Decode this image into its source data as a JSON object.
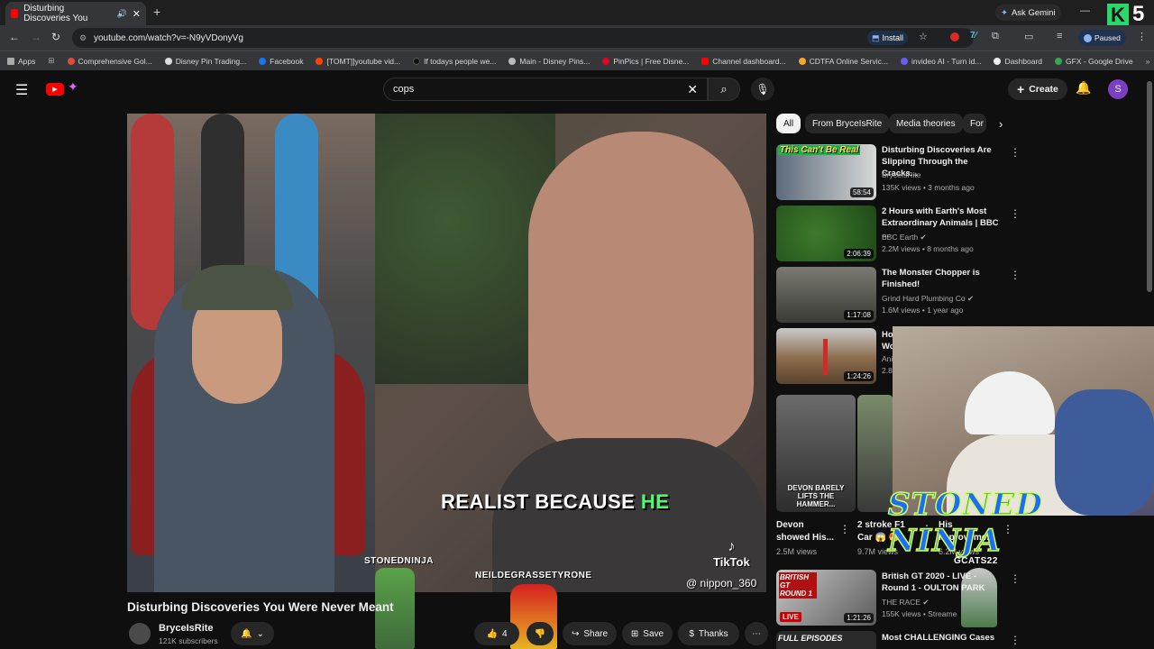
{
  "browser": {
    "tab_title": "Disturbing Discoveries You",
    "url": "youtube.com/watch?v=-N9yVDonyVg",
    "ask_gemini": "Ask Gemini",
    "install": "Install",
    "paused": "Paused",
    "bookmarks": [
      "Apps",
      "Comprehensive Gol...",
      "Disney Pin Trading...",
      "Facebook",
      "[TOMT]]youtube vid...",
      "If todays people we...",
      "Main - Disney Pins...",
      "PinPics | Free Disne...",
      "Channel dashboard...",
      "CDTFA Online Servic...",
      "invideo AI - Turn id...",
      "Dashboard",
      "GFX - Google Drive"
    ]
  },
  "header": {
    "search_value": "cops",
    "create_label": "Create",
    "avatar_letter": "S"
  },
  "video": {
    "caption_main": "REALIST BECAUSE",
    "caption_highlight": "HE",
    "tiktok_label": "TikTok",
    "tiktok_handle": "@ nippon_360",
    "title": "Disturbing Discoveries You Were Never Meant",
    "channel": "BryceIsRite",
    "subscribers": "121K subscribers",
    "like_count": "4",
    "share_label": "Share",
    "save_label": "Save",
    "thanks_label": "Thanks",
    "overlay_stonedninja": "STONEDNINJA",
    "overlay_neil": "NEILDEGRASSETYRONE",
    "overlay_gcat": "GCATS22"
  },
  "chips": [
    "All",
    "From BryceIsRite",
    "Media theories",
    "For"
  ],
  "recommendations": [
    {
      "title": "Disturbing Discoveries Are Slipping Through the Cracks...",
      "channel": "BryceIsRite",
      "meta": "135K views • 3 months ago",
      "duration": "58:54",
      "thumb_text": "This Can't Be Real"
    },
    {
      "title": "2 Hours with Earth's Most Extraordinary Animals | BBC ...",
      "channel": "BBC Earth",
      "meta": "2.2M views • 8 months ago",
      "duration": "2:06:39"
    },
    {
      "title": "The Monster Chopper is Finished!",
      "channel": "Grind Hard Plumbing Co",
      "meta": "1.6M views • 1 year ago",
      "duration": "1:17:08"
    },
    {
      "title": "Ho Wo",
      "channel": "Ani",
      "meta": "2.8",
      "duration": "1:24:26"
    },
    {
      "title": "British GT 2020 - LIVE - Round 1 - OULTON PARK",
      "channel": "THE RACE",
      "meta": "155K views • Streame",
      "duration": "1:21:26",
      "thumb_text": "BRITISH GT ROUND 1",
      "live": "LIVE"
    },
    {
      "title": "Most CHALLENGING Cases",
      "channel": "",
      "meta": "",
      "duration": "",
      "thumb_text": "FULL EPISODES"
    }
  ],
  "shorts": [
    {
      "title": "Devon showed His...",
      "views": "2.5M views",
      "thumb_text": "DEVON BARELY LIFTS THE HAMMER..."
    },
    {
      "title": "2 stroke F1 Car 😱 😍",
      "views": "9.7M views"
    },
    {
      "title": "His Improveme...",
      "views": "6.2M views"
    }
  ],
  "overlay_text": "STONED NINJA",
  "sticker": {
    "letter": "K",
    "number": "5"
  }
}
